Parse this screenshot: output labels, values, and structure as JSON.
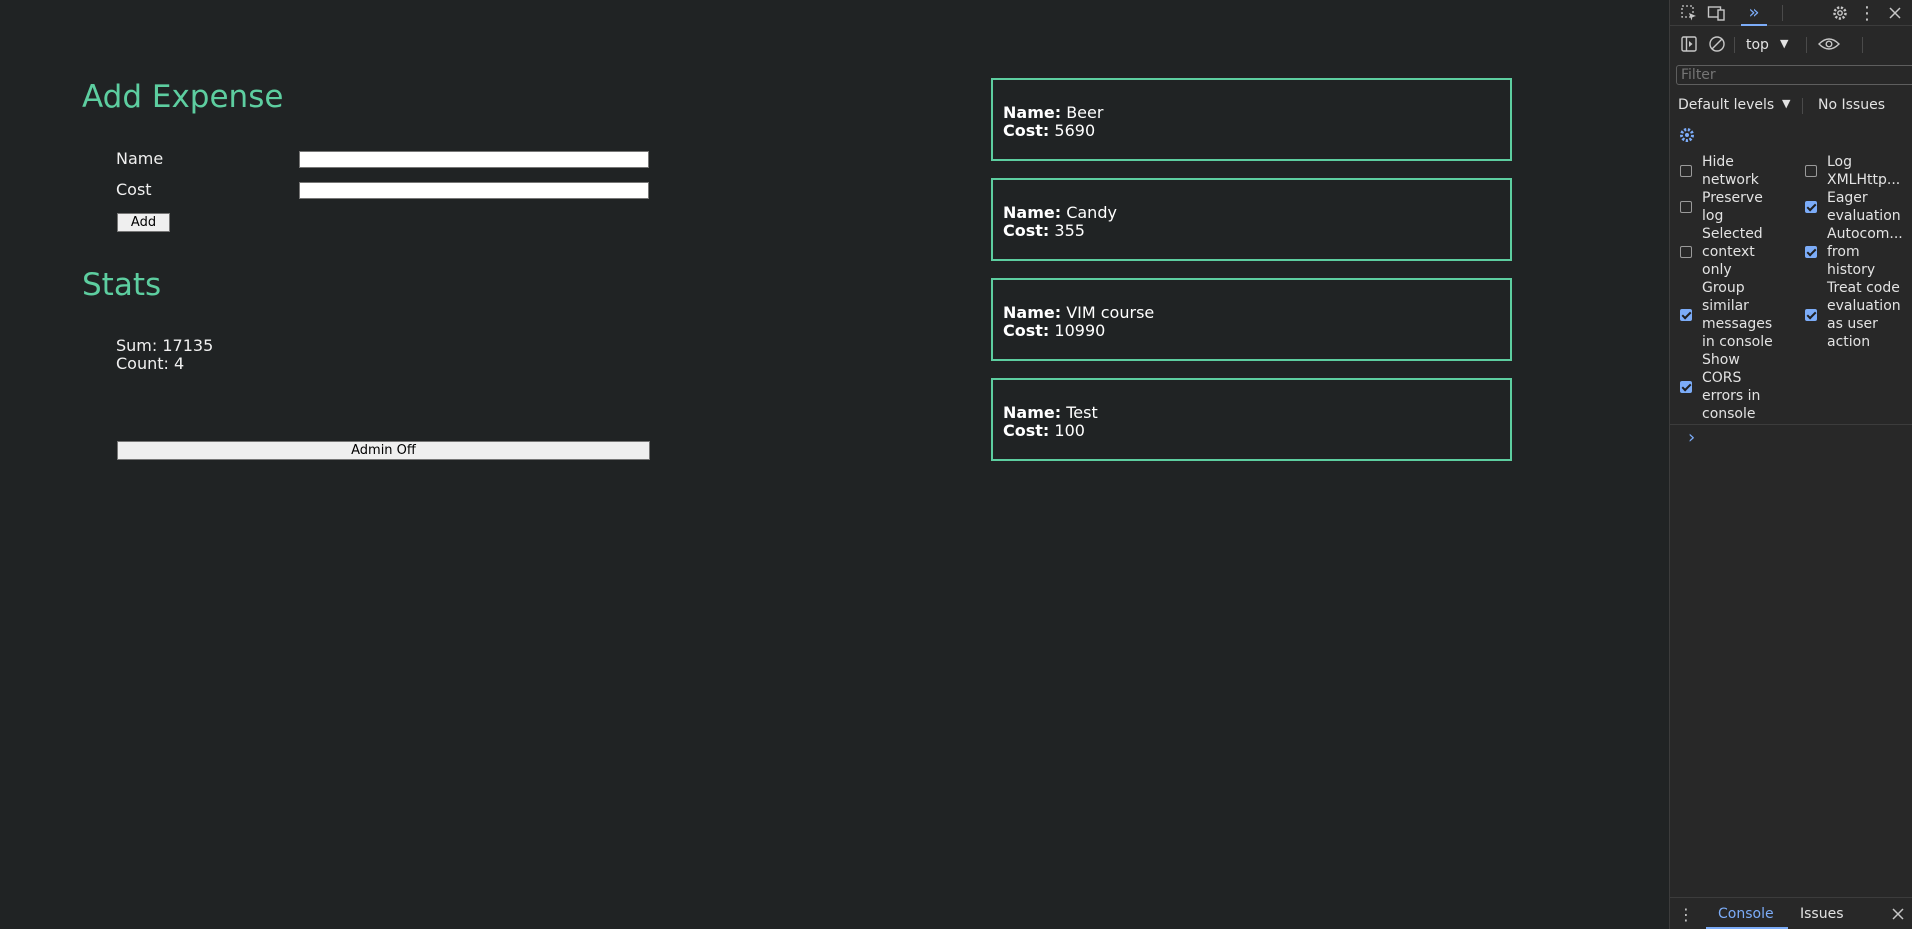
{
  "form": {
    "title": "Add Expense",
    "name_label": "Name",
    "cost_label": "Cost",
    "name_value": "",
    "cost_value": "",
    "add_button": "Add"
  },
  "stats": {
    "title": "Stats",
    "sum_text": "Sum: 17135",
    "count_text": "Count: 4",
    "admin_button": "Admin Off"
  },
  "expenses": [
    {
      "name_label": "Name:",
      "name": "Beer",
      "cost_label": "Cost:",
      "cost": "5690"
    },
    {
      "name_label": "Name:",
      "name": "Candy",
      "cost_label": "Cost:",
      "cost": "355"
    },
    {
      "name_label": "Name:",
      "name": "VIM course",
      "cost_label": "Cost:",
      "cost": "10990"
    },
    {
      "name_label": "Name:",
      "name": "Test",
      "cost_label": "Cost:",
      "cost": "100"
    }
  ],
  "devtools": {
    "context": "top",
    "filter_placeholder": "Filter",
    "levels": "Default levels",
    "issues_status": "No Issues",
    "settings": {
      "left": [
        {
          "label": "Hide network",
          "checked": false
        },
        {
          "label": "Preserve log",
          "checked": false
        },
        {
          "label": "Selected context only",
          "checked": false
        },
        {
          "label": "Group similar messages in console",
          "checked": true
        },
        {
          "label": "Show CORS errors in console",
          "checked": true
        }
      ],
      "right": [
        {
          "label": "Log XMLHttp...",
          "checked": false
        },
        {
          "label": "Eager evaluation",
          "checked": true
        },
        {
          "label": "Autocom... from history",
          "checked": true
        },
        {
          "label": "Treat code evaluation as user action",
          "checked": true
        }
      ]
    },
    "prompt_glyph": "›",
    "bottom_tabs": {
      "console": "Console",
      "issues": "Issues"
    },
    "colors": {
      "accent": "#7cacf8",
      "app_accent": "#5dcea0"
    }
  }
}
